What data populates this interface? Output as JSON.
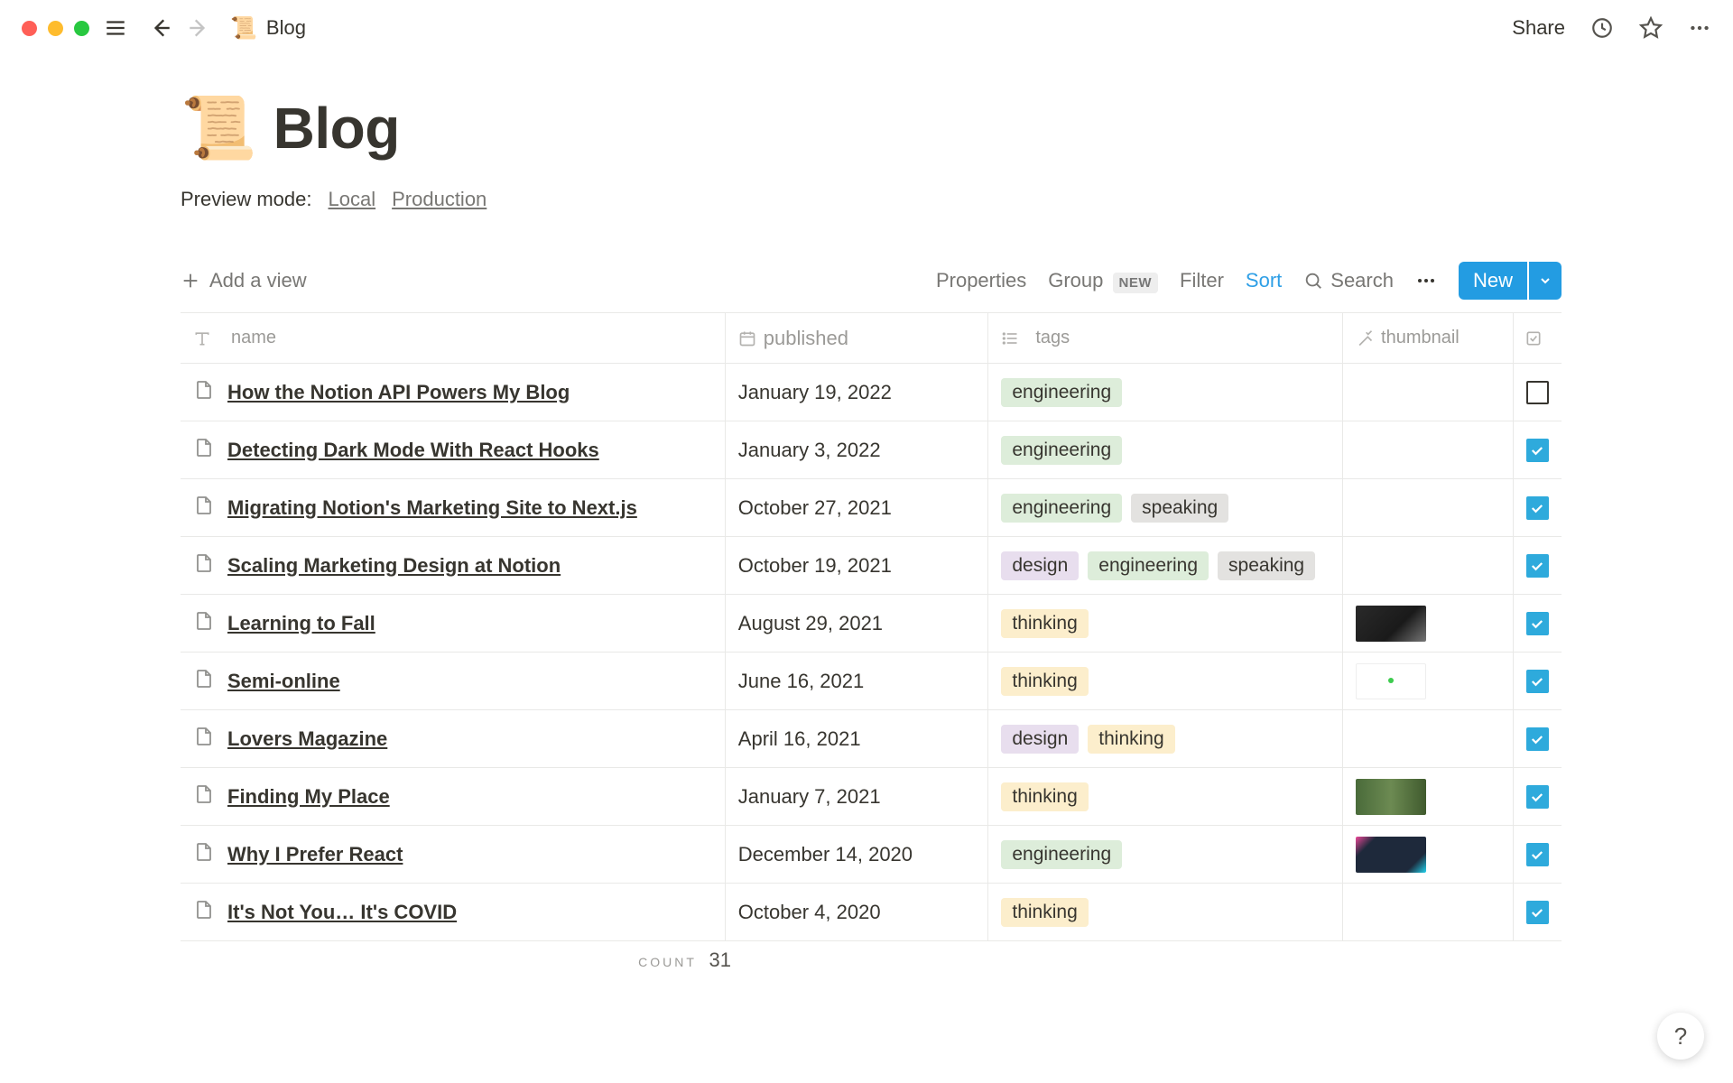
{
  "breadcrumb": {
    "emoji": "📜",
    "title": "Blog"
  },
  "topbar": {
    "share": "Share"
  },
  "page": {
    "emoji": "📜",
    "title": "Blog",
    "preview_label": "Preview mode:",
    "preview_local": "Local",
    "preview_production": "Production"
  },
  "toolbar": {
    "add_view": "Add a view",
    "properties": "Properties",
    "group": "Group",
    "group_badge": "NEW",
    "filter": "Filter",
    "sort": "Sort",
    "search": "Search",
    "new": "New"
  },
  "columns": {
    "name": "name",
    "published": "published",
    "tags": "tags",
    "thumbnail": "thumbnail"
  },
  "rows": [
    {
      "name": "How the Notion API Powers My Blog",
      "published": "January 19, 2022",
      "tags": [
        "engineering"
      ],
      "thumb": null,
      "checked": false
    },
    {
      "name": "Detecting Dark Mode With React Hooks",
      "published": "January 3, 2022",
      "tags": [
        "engineering"
      ],
      "thumb": null,
      "checked": true
    },
    {
      "name": "Migrating Notion's Marketing Site to Next.js",
      "published": "October 27, 2021",
      "tags": [
        "engineering",
        "speaking"
      ],
      "thumb": null,
      "checked": true
    },
    {
      "name": "Scaling Marketing Design at Notion",
      "published": "October 19, 2021",
      "tags": [
        "design",
        "engineering",
        "speaking"
      ],
      "thumb": null,
      "checked": true
    },
    {
      "name": "Learning to Fall",
      "published": "August 29, 2021",
      "tags": [
        "thinking"
      ],
      "thumb": "shoes",
      "checked": true
    },
    {
      "name": "Semi-online",
      "published": "June 16, 2021",
      "tags": [
        "thinking"
      ],
      "thumb": "dot",
      "checked": true
    },
    {
      "name": "Lovers Magazine",
      "published": "April 16, 2021",
      "tags": [
        "design",
        "thinking"
      ],
      "thumb": null,
      "checked": true
    },
    {
      "name": "Finding My Place",
      "published": "January 7, 2021",
      "tags": [
        "thinking"
      ],
      "thumb": "cows",
      "checked": true
    },
    {
      "name": "Why I Prefer React",
      "published": "December 14, 2020",
      "tags": [
        "engineering"
      ],
      "thumb": "react",
      "checked": true
    },
    {
      "name": "It's Not You… It's COVID",
      "published": "October 4, 2020",
      "tags": [
        "thinking"
      ],
      "thumb": null,
      "checked": true
    }
  ],
  "footer": {
    "label": "COUNT",
    "value": "31"
  },
  "help": "?"
}
